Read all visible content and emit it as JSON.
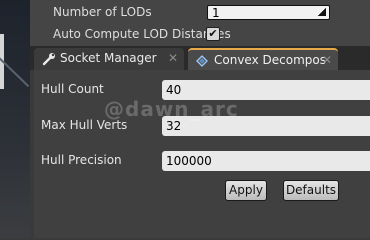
{
  "details": {
    "num_lods_label": "Number of LODs",
    "num_lods_value": "1",
    "auto_compute_label": "Auto Compute LOD Distances",
    "auto_compute_checked": true
  },
  "tabs": [
    {
      "label": "Socket Manager",
      "icon": "wrench-icon",
      "active": false
    },
    {
      "label": "Convex Decompos",
      "icon": "convex-hull-icon",
      "active": true
    }
  ],
  "convex": {
    "hull_count_label": "Hull Count",
    "hull_count_value": "40",
    "max_hull_verts_label": "Max Hull Verts",
    "max_hull_verts_value": "32",
    "hull_precision_label": "Hull Precision",
    "hull_precision_value": "100000",
    "apply_label": "Apply",
    "defaults_label": "Defaults"
  },
  "watermark": "@dawn_arc",
  "colors": {
    "active_tab_accent": "#e8a94a",
    "panel_bg": "#404040"
  }
}
